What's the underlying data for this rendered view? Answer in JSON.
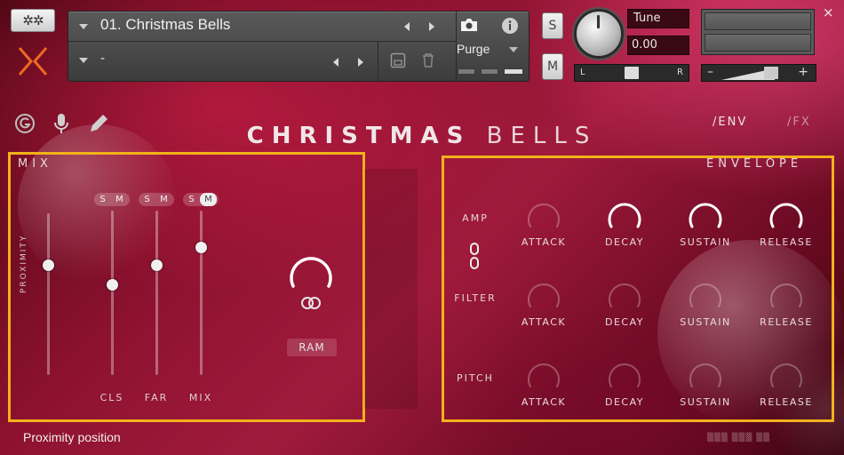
{
  "header": {
    "settings_icon": "gear-icon",
    "logo_icon": "x-logo-icon",
    "instrument_name": "01. Christmas Bells",
    "snapshot_name": "-",
    "purge_label": "Purge",
    "solo_label": "S",
    "mute_label": "M",
    "tune_label": "Tune",
    "tune_value": "0.00",
    "pan_left": "L",
    "pan_right": "R",
    "vol_minus": "–",
    "vol_plus": "+",
    "close": "×"
  },
  "title": {
    "bold": "CHRISTMAS",
    "light": "BELLS"
  },
  "nav": {
    "env": "/ENV",
    "fx": "/FX"
  },
  "top_icons": [
    "g-icon",
    "microphone-icon",
    "pencil-icon"
  ],
  "mix": {
    "label": "MIX",
    "proximity_label": "PROXIMITY",
    "proximity_level": 0.68,
    "channels": [
      {
        "label": "CLS",
        "solo": "S",
        "mute": "M",
        "level": 0.55
      },
      {
        "label": "FAR",
        "solo": "S",
        "mute": "M",
        "level": 0.67
      },
      {
        "label": "MIX",
        "solo": "S",
        "mute": "M",
        "level": 0.78
      }
    ],
    "ram_label": "RAM"
  },
  "envelope": {
    "label": "ENVELOPE",
    "rows": [
      {
        "label": "AMP",
        "knobs": [
          "ATTACK",
          "DECAY",
          "SUSTAIN",
          "RELEASE"
        ],
        "active": true
      },
      {
        "label": "FILTER",
        "knobs": [
          "ATTACK",
          "DECAY",
          "SUSTAIN",
          "RELEASE"
        ],
        "active": false
      },
      {
        "label": "PITCH",
        "knobs": [
          "ATTACK",
          "DECAY",
          "SUSTAIN",
          "RELEASE"
        ],
        "active": false
      }
    ]
  },
  "status": {
    "text": "Proximity position"
  },
  "colors": {
    "highlight": "#f2b21b",
    "background": "#8e1230"
  }
}
